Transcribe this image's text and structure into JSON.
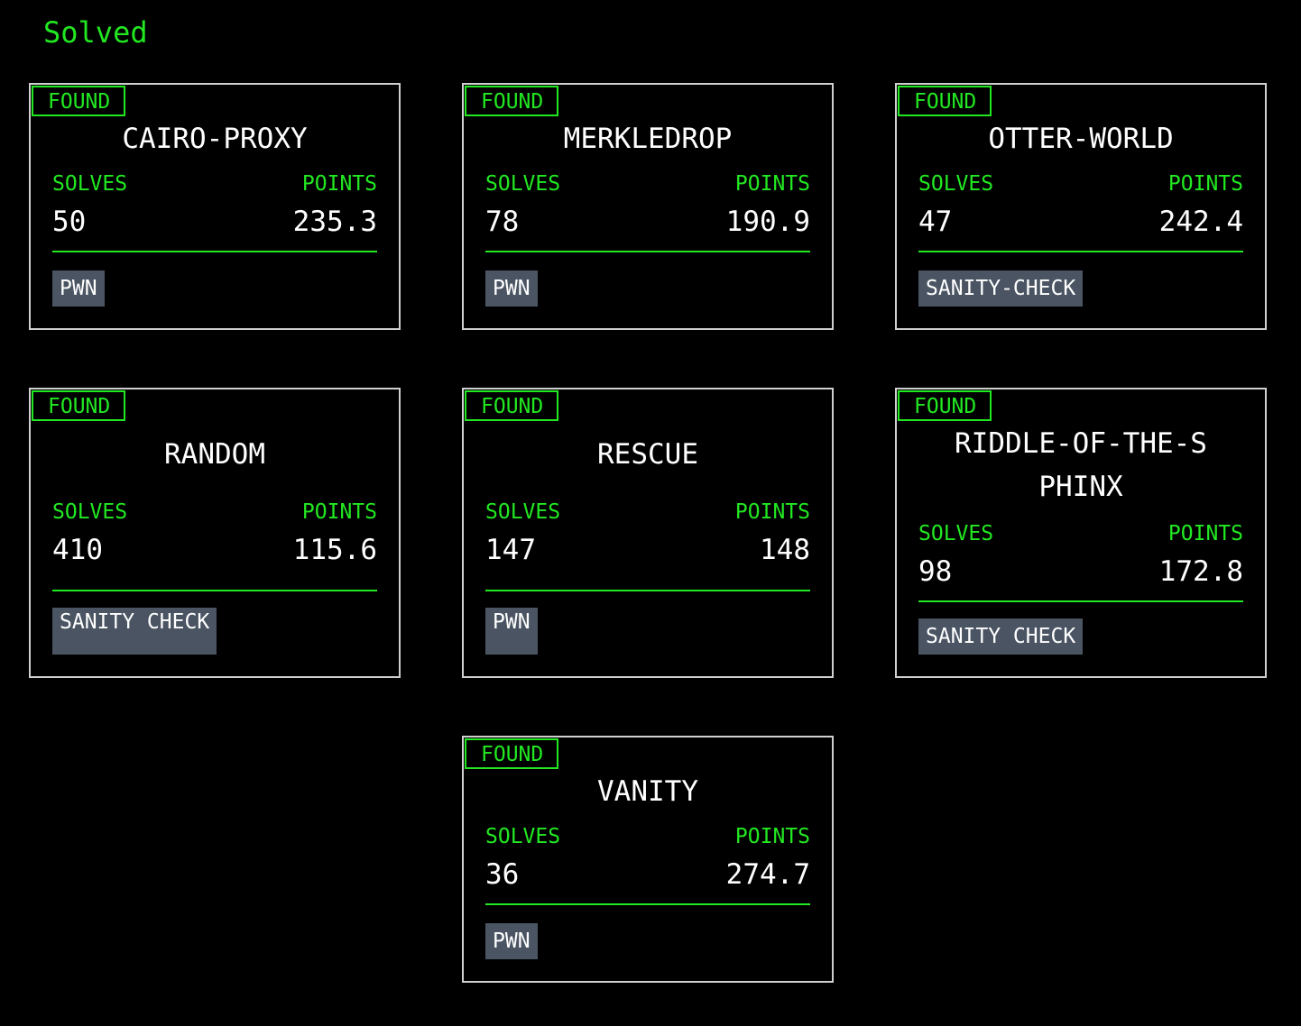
{
  "section_title": "Solved",
  "cards": [
    {
      "badge": "FOUND",
      "title": "CAIRO-PROXY",
      "solves_label": "SOLVES",
      "points_label": "POINTS",
      "solves": "50",
      "points": "235.3",
      "tag": "PWN"
    },
    {
      "badge": "FOUND",
      "title": "MERKLEDROP",
      "solves_label": "SOLVES",
      "points_label": "POINTS",
      "solves": "78",
      "points": "190.9",
      "tag": "PWN"
    },
    {
      "badge": "FOUND",
      "title": "OTTER-WORLD",
      "solves_label": "SOLVES",
      "points_label": "POINTS",
      "solves": "47",
      "points": "242.4",
      "tag": "SANITY-CHECK"
    },
    {
      "badge": "FOUND",
      "title": "RANDOM",
      "solves_label": "SOLVES",
      "points_label": "POINTS",
      "solves": "410",
      "points": "115.6",
      "tag": "SANITY CHECK"
    },
    {
      "badge": "FOUND",
      "title": "RESCUE",
      "solves_label": "SOLVES",
      "points_label": "POINTS",
      "solves": "147",
      "points": "148",
      "tag": "PWN"
    },
    {
      "badge": "FOUND",
      "title": "RIDDLE-OF-THE-SPHINX",
      "solves_label": "SOLVES",
      "points_label": "POINTS",
      "solves": "98",
      "points": "172.8",
      "tag": "SANITY CHECK"
    },
    {
      "badge": "FOUND",
      "title": "VANITY",
      "solves_label": "SOLVES",
      "points_label": "POINTS",
      "solves": "36",
      "points": "274.7",
      "tag": "PWN"
    }
  ],
  "colors": {
    "accent": "#22e822",
    "background": "#000000",
    "border": "#d0d0d0",
    "tag_bg": "#4a5462"
  }
}
